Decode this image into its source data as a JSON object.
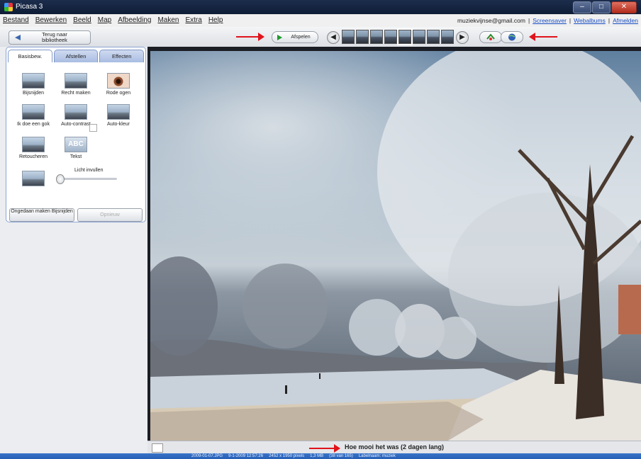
{
  "window": {
    "title": "Picasa 3",
    "min": "–",
    "max": "□",
    "close": "✕"
  },
  "menu": [
    "Bestand",
    "Bewerken",
    "Beeld",
    "Map",
    "Afbeelding",
    "Maken",
    "Extra",
    "Help"
  ],
  "account": {
    "email": "muziekvijnse@gmail.com",
    "links": [
      "Screensaver",
      "Webalbums",
      "Afmelden"
    ],
    "sep": "|"
  },
  "toolbar": {
    "back_label": "Terug naar bibliotheek",
    "play_label": "Afspelen",
    "prev_symbol": "◀",
    "next_symbol": "▶",
    "thumb_count": 8,
    "selected_thumb": 4
  },
  "edit_panel": {
    "tabs": [
      "Basisbew.",
      "Afstellen",
      "Effecten"
    ],
    "active_tab": 0,
    "tools": [
      "Bijsnijden",
      "Recht maken",
      "Rode ogen",
      "Ik doe een gok",
      "Auto-contrast",
      "Auto-kleur",
      "Retoucheren",
      "Tekst"
    ],
    "text_icon_label": "ABC",
    "fill_light_label": "Licht invullen",
    "fill_light_value": 0,
    "undo_label": "Ongedaan maken Bijsnijden",
    "redo_label": "Opnieuw"
  },
  "photo": {
    "caption": "Hoe mooi het was (2 dagen lang)"
  },
  "status": {
    "filename": "2009-01-07.JPG",
    "date": "9-1-2009 12:57:26",
    "size_px": "2452 x 1950 pixels",
    "filesize": "1,3 MB",
    "position": "(38 van 165)",
    "label": "Labelnaam: muziek"
  },
  "colors": {
    "accent": "#2660b7",
    "annotation": "#e0131b",
    "titlebar": "#0f1d36"
  }
}
